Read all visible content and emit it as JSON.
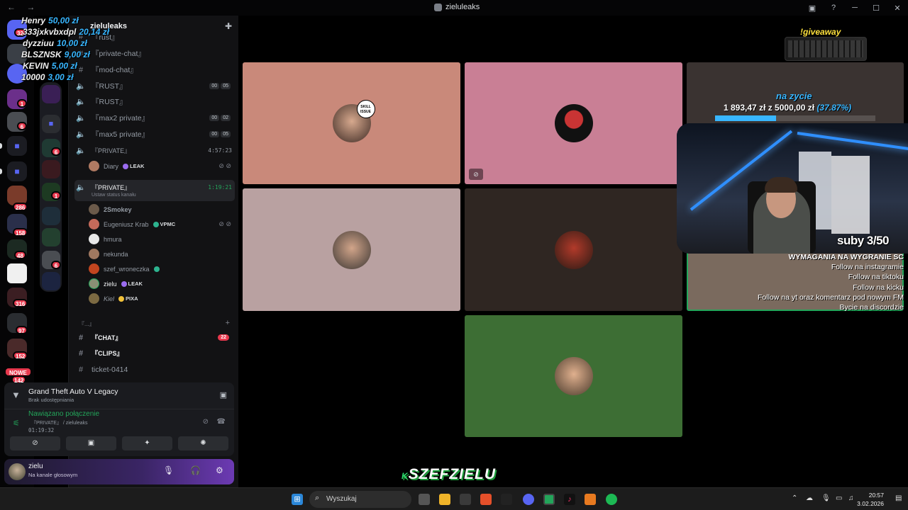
{
  "window": {
    "title": "zieluleaks",
    "nav": "← →",
    "controls": [
      "▣",
      "?",
      "─",
      "☐",
      "✕"
    ]
  },
  "rail": {
    "badges": [
      "1",
      "6",
      "286",
      "158",
      "48",
      "316",
      "97",
      "152",
      "142"
    ],
    "new_label": "NOWE",
    "home_badge": "32"
  },
  "folder": {
    "badges": [
      "6",
      "1",
      "6"
    ]
  },
  "guild": {
    "name": "zieluleaks",
    "channels": [
      {
        "icon": "#",
        "name": "『rust』",
        "partial": true
      },
      {
        "icon": "#",
        "name": "『private-chat』"
      },
      {
        "icon": "#",
        "name": "『mod-chat』"
      },
      {
        "icon": "🔈",
        "name": "『RUST』",
        "counts": [
          "00",
          "05"
        ]
      },
      {
        "icon": "🔈",
        "name": "『RUST』"
      },
      {
        "icon": "🔈",
        "name": "『max2 private』",
        "counts": [
          "00",
          "02"
        ]
      },
      {
        "icon": "🔈",
        "name": "『max5 private』",
        "counts": [
          "00",
          "05"
        ]
      },
      {
        "icon": "🔈",
        "name": "『PRIVATE』",
        "time": "4:57:23"
      }
    ],
    "first_voice_users": [
      {
        "name": "Diary",
        "tag": "LEAK"
      }
    ],
    "active_channel": {
      "name": "『PRIVATE』",
      "sub": "Ustaw status kanału",
      "time": "1:19:21"
    },
    "members": [
      {
        "name": "2Smokey",
        "tag": ""
      },
      {
        "name": "Eugeniusz Krab",
        "tag": "VPMC"
      },
      {
        "name": "hmura",
        "tag": ""
      },
      {
        "name": "nekunda",
        "tag": ""
      },
      {
        "name": "szef_wroneczka",
        "tag": ""
      },
      {
        "name": "zielu",
        "tag": "LEAK"
      },
      {
        "name": "Kiel",
        "tag": "PIXA"
      }
    ],
    "category": "『...』",
    "text_channels": [
      {
        "name": "『CHAT』",
        "mentions": "22"
      },
      {
        "name": "『CLIPS』"
      },
      {
        "name": "ticket-0414"
      }
    ]
  },
  "activity": {
    "game": "Grand Theft Auto V Legacy",
    "game_sub": "Brak udostępniania",
    "voice_status": "Nawiązano połączenie",
    "voice_channel": "『PRIVATE』 / zieluleaks",
    "voice_time": "01:19:32"
  },
  "user": {
    "name": "zielu",
    "status": "Na kanale głosowym"
  },
  "donations": [
    {
      "name": "Henry",
      "amount": "50,00 zł"
    },
    {
      "name": "333jxkvbxdpl",
      "amount": "20,14 zł"
    },
    {
      "name": "dyzziuu",
      "amount": "10,00 zł"
    },
    {
      "name": "BLSZNSK",
      "amount": "9,00 zł"
    },
    {
      "name": "KEVIN",
      "amount": "5,00 zł"
    },
    {
      "name": "10000",
      "amount": "3,00 zł"
    }
  ],
  "overlay": {
    "giveaway": "!giveaway",
    "goal_title": "na zycie",
    "goal_value": "1 893,47 zł z 5000,00 zł",
    "goal_percent": "(37.87%)",
    "goal_fraction": 0.3787,
    "subs": "suby 3/50",
    "requirements": [
      "WYMAGANIA NA WYGRANIE SC",
      "Follow na instagramie",
      "Follow na tiktoku",
      "Follow na kicku",
      "Follow na yt oraz komentarz pod nowym FM",
      "Bycie na discordzie"
    ],
    "skill_badge": "SKILL ISSUE",
    "logo": "SZEFZIELU",
    "logo_prefix": "K"
  },
  "tiles": [
    {
      "bg": "#c9897a"
    },
    {
      "bg": "#c97f95"
    },
    {
      "bg": "#b9a1a1"
    },
    {
      "bg": "#2f2622"
    },
    {
      "bg": "#3d6e34"
    },
    {
      "bg": "#3a3331"
    },
    {
      "bg": "#7a6a5e"
    }
  ],
  "taskbar": {
    "search_placeholder": "Wyszukaj",
    "time": "20:57",
    "date": "3.02.2026"
  },
  "colors": {
    "accent_green": "#23a55a",
    "mention_red": "#e8384d",
    "overlay_blue": "#38b6ff",
    "giveaway_yellow": "#ffe23d"
  }
}
